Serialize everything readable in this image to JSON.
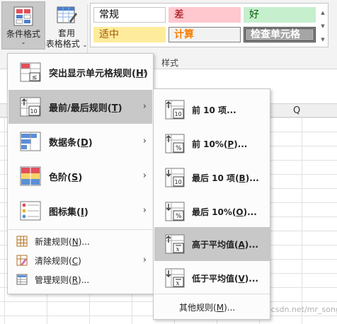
{
  "ribbon": {
    "conditional_format": {
      "line1": "条件格式",
      "caret": "⌄"
    },
    "format_as_table": {
      "line1": "套用",
      "line2": "表格格式",
      "caret": "⌄"
    },
    "styles": {
      "normal": "常规",
      "bad": "差",
      "good": "好",
      "neutral": "适中",
      "calculation": "计算",
      "check_cell": "检查单元格"
    },
    "group_label": "样式"
  },
  "sheet": {
    "column_q": "Q"
  },
  "menu": {
    "items": [
      {
        "label": "突出显示单元格规则",
        "key": "H",
        "icon": "highlight-cells-rules-icon"
      },
      {
        "label": "最前/最后规则",
        "key": "T",
        "icon": "top-bottom-rules-icon"
      },
      {
        "label": "数据条",
        "key": "D",
        "icon": "data-bars-icon"
      },
      {
        "label": "色阶",
        "key": "S",
        "icon": "color-scales-icon"
      },
      {
        "label": "图标集",
        "key": "I",
        "icon": "icon-sets-icon"
      }
    ],
    "small_items": [
      {
        "label": "新建规则",
        "key": "N",
        "suffix": "...",
        "icon": "new-rule-icon"
      },
      {
        "label": "清除规则",
        "key": "C",
        "suffix": "",
        "icon": "clear-rules-icon"
      },
      {
        "label": "管理规则",
        "key": "R",
        "suffix": "...",
        "icon": "manage-rules-icon"
      }
    ]
  },
  "submenu": {
    "items": [
      {
        "label": "前 10 项",
        "key": "",
        "suffix": "...",
        "icon": "top-10-items-icon"
      },
      {
        "label": "前 10%",
        "key": "P",
        "suffix": "...",
        "icon": "top-10-percent-icon"
      },
      {
        "label": "最后 10 项",
        "key": "B",
        "suffix": "...",
        "icon": "bottom-10-items-icon"
      },
      {
        "label": "最后 10%",
        "key": "O",
        "suffix": "...",
        "icon": "bottom-10-percent-icon"
      },
      {
        "label": "高于平均值",
        "key": "A",
        "suffix": "...",
        "icon": "above-average-icon"
      },
      {
        "label": "低于平均值",
        "key": "V",
        "suffix": "...",
        "icon": "below-average-icon"
      }
    ],
    "more": {
      "label": "其他规则",
      "key": "M",
      "suffix": "..."
    }
  },
  "watermark": "https://blog.csdn.net/mr_songw",
  "colors": {
    "ribbon_bg": "#f3f3f3",
    "active_bg": "#c8c8c8",
    "bad_bg": "#ffc7ce",
    "good_bg": "#c6efce",
    "neutral_bg": "#ffeb9c",
    "check_bg": "#a5a5a5"
  }
}
